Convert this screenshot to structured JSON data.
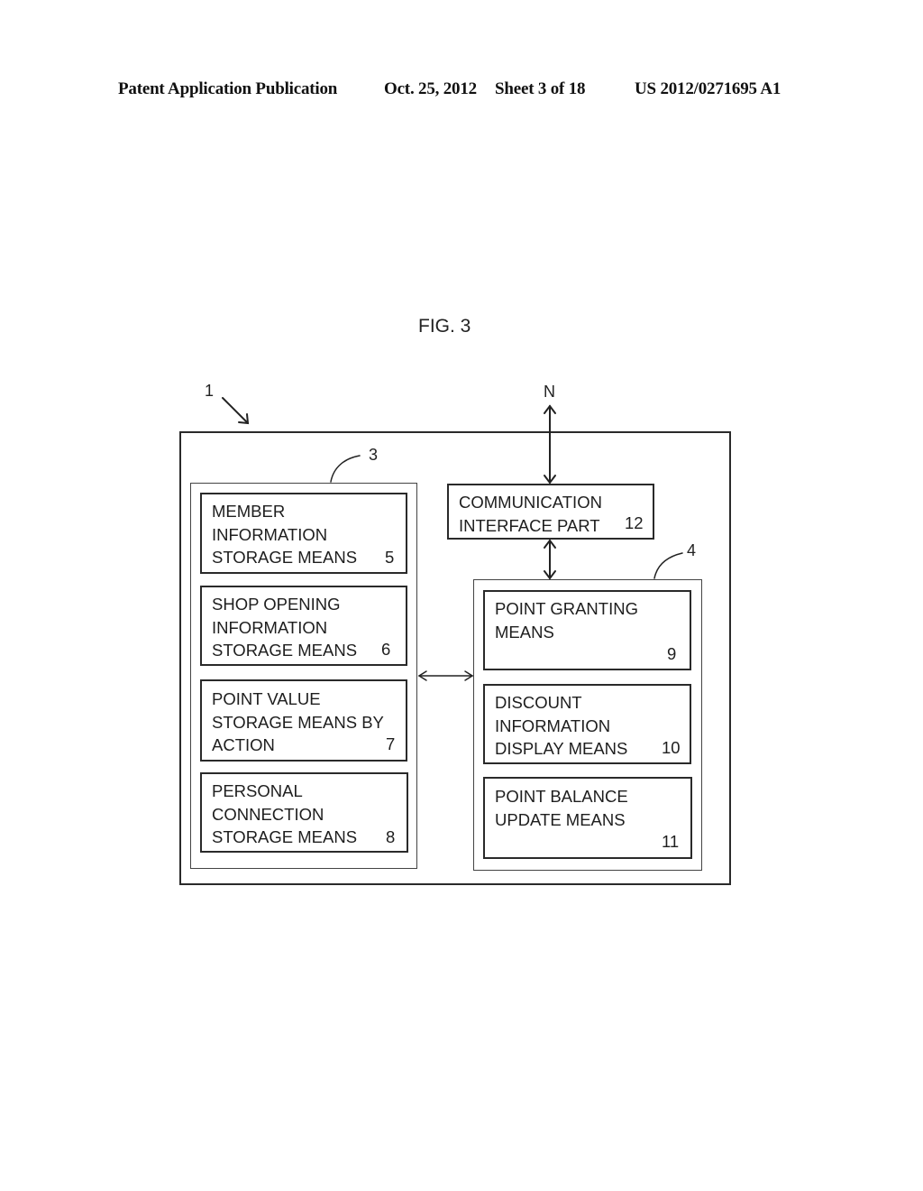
{
  "header": {
    "publication": "Patent Application Publication",
    "date": "Oct. 25, 2012",
    "sheet": "Sheet 3 of 18",
    "number": "US 2012/0271695 A1"
  },
  "figure": {
    "title": "FIG. 3",
    "system_ref": "1",
    "network_label": "N",
    "left_group_ref": "3",
    "right_group_ref": "4",
    "communication": {
      "lines": [
        "COMMUNICATION",
        "INTERFACE PART"
      ],
      "ref": "12"
    },
    "left_blocks": [
      {
        "lines": [
          "MEMBER",
          "INFORMATION",
          "STORAGE MEANS"
        ],
        "ref": "5"
      },
      {
        "lines": [
          "SHOP OPENING",
          "INFORMATION",
          "STORAGE MEANS"
        ],
        "ref": "6"
      },
      {
        "lines": [
          "POINT VALUE",
          "STORAGE MEANS BY",
          "ACTION"
        ],
        "ref": "7"
      },
      {
        "lines": [
          "PERSONAL",
          "CONNECTION",
          "STORAGE MEANS"
        ],
        "ref": "8"
      }
    ],
    "right_blocks": [
      {
        "lines": [
          "POINT GRANTING",
          "MEANS"
        ],
        "ref": "9"
      },
      {
        "lines": [
          "DISCOUNT",
          "INFORMATION",
          "DISPLAY MEANS"
        ],
        "ref": "10"
      },
      {
        "lines": [
          "POINT BALANCE",
          "UPDATE MEANS"
        ],
        "ref": "11"
      }
    ]
  }
}
